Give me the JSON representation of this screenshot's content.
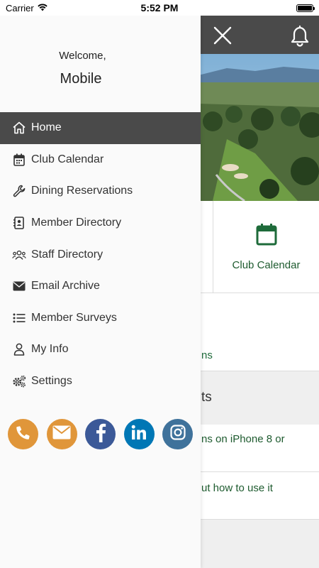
{
  "status_bar": {
    "carrier": "Carrier",
    "time": "5:52 PM"
  },
  "drawer": {
    "welcome": "Welcome,",
    "user_name": "Mobile",
    "items": [
      {
        "label": "Home",
        "icon": "home-icon",
        "active": true
      },
      {
        "label": "Club Calendar",
        "icon": "calendar-icon"
      },
      {
        "label": "Dining Reservations",
        "icon": "wrench-icon"
      },
      {
        "label": "Member Directory",
        "icon": "address-book-icon"
      },
      {
        "label": "Staff Directory",
        "icon": "users-icon"
      },
      {
        "label": "Email Archive",
        "icon": "envelope-icon"
      },
      {
        "label": "Member Surveys",
        "icon": "list-icon"
      },
      {
        "label": "My Info",
        "icon": "user-icon"
      },
      {
        "label": "Settings",
        "icon": "gears-icon"
      }
    ],
    "social": [
      {
        "name": "phone",
        "color": "#E0963A"
      },
      {
        "name": "email",
        "color": "#E0963A"
      },
      {
        "name": "facebook",
        "color": "#3B5998"
      },
      {
        "name": "linkedin",
        "color": "#0077B5"
      },
      {
        "name": "instagram",
        "color": "#3F729B"
      }
    ]
  },
  "background": {
    "tile_label": "Club Calendar",
    "card_text": "ns",
    "section_title": "ts",
    "row1_text": "ns on iPhone 8 or",
    "row2_text": "ut how to use it"
  },
  "colors": {
    "header": "#4A4A4A",
    "accent_green": "#1E5B2F"
  }
}
